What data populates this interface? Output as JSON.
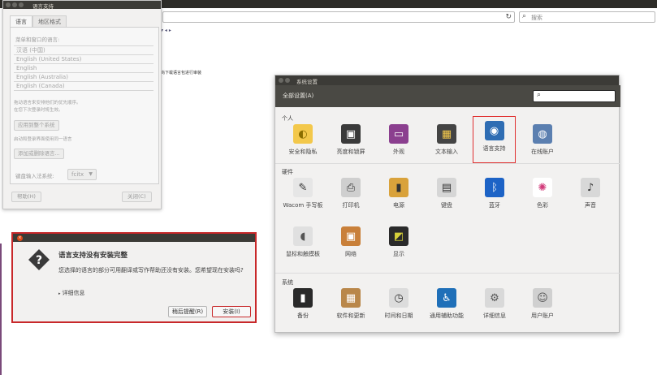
{
  "browser": {
    "search_placeholder": "搜索",
    "bg_text": "尚下载语言包进行审装"
  },
  "lang_dialog": {
    "title": "语言支持",
    "tabs": [
      "语言",
      "地区格式"
    ],
    "menu_label": "菜单和窗口的语言:",
    "languages": [
      "汉语 (中国)",
      "English (United States)",
      "English",
      "English (Australia)",
      "English (Canada)"
    ],
    "drag_hint": "拖动语言来安排他们的优先顺序。",
    "effect_hint": "在您下次登录时将生效。",
    "apply_system": "应用到整个系统",
    "apply_hint": "启动和登录界面使用同一语言",
    "add_remove": "添加或删除语言...",
    "ime_label": "键盘输入法系统:",
    "ime_value": "fcitx",
    "help": "帮助(H)",
    "close": "关闭(C)"
  },
  "alert": {
    "title": "语言支持没有安装完整",
    "message": "您选择的语言的部分可用翻译或写作帮助还没有安装。您希望现在安装吗?",
    "details": "详细信息",
    "later": "稍后提醒(R)",
    "install": "安装(I)"
  },
  "settings": {
    "title": "系统设置",
    "all_settings": "全部设置(A)",
    "sections": {
      "personal": "个人",
      "hardware": "硬件",
      "system": "系统"
    },
    "personal": [
      {
        "label": "安全和隐私",
        "icon": "security-privacy-icon"
      },
      {
        "label": "亮度和锁屏",
        "icon": "brightness-lock-icon"
      },
      {
        "label": "外观",
        "icon": "appearance-icon"
      },
      {
        "label": "文本输入",
        "icon": "text-entry-icon"
      },
      {
        "label": "语言支持",
        "icon": "language-support-icon"
      },
      {
        "label": "在线账户",
        "icon": "online-accounts-icon"
      }
    ],
    "hardware": [
      {
        "label": "Wacom 手写板",
        "icon": "wacom-tablet-icon"
      },
      {
        "label": "打印机",
        "icon": "printer-icon"
      },
      {
        "label": "电源",
        "icon": "power-icon"
      },
      {
        "label": "键盘",
        "icon": "keyboard-icon"
      },
      {
        "label": "蓝牙",
        "icon": "bluetooth-icon"
      },
      {
        "label": "色彩",
        "icon": "color-icon"
      },
      {
        "label": "声音",
        "icon": "sound-icon"
      },
      {
        "label": "鼠标和触摸板",
        "icon": "mouse-touchpad-icon"
      },
      {
        "label": "网络",
        "icon": "network-icon"
      },
      {
        "label": "显示",
        "icon": "display-icon"
      }
    ],
    "system": [
      {
        "label": "备份",
        "icon": "backup-icon"
      },
      {
        "label": "软件和更新",
        "icon": "software-updates-icon"
      },
      {
        "label": "时间和日期",
        "icon": "time-date-icon"
      },
      {
        "label": "通用辅助功能",
        "icon": "universal-access-icon"
      },
      {
        "label": "详细信息",
        "icon": "details-icon"
      },
      {
        "label": "用户账户",
        "icon": "user-accounts-icon"
      }
    ]
  }
}
